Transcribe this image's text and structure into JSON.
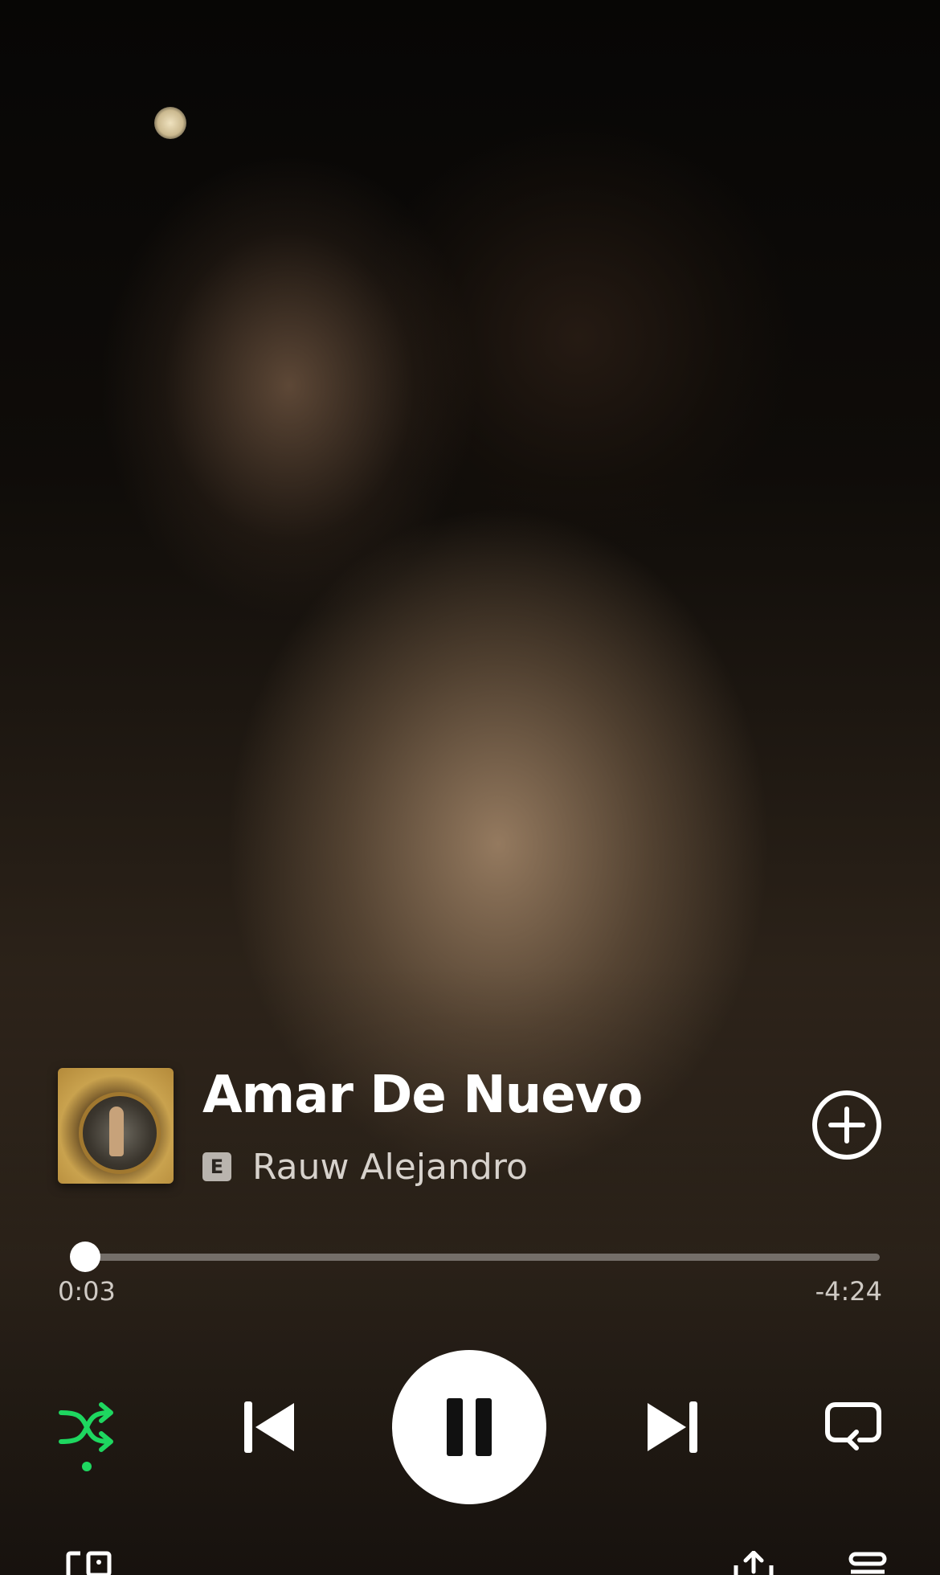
{
  "track": {
    "title": "Amar De Nuevo",
    "artist": "Rauw Alejandro",
    "explicit_badge": "E"
  },
  "playback": {
    "elapsed": "0:03",
    "remaining": "-4:24",
    "progress_fraction": 0.011,
    "state": "playing",
    "shuffle_enabled": true
  },
  "icons": {
    "add": "plus-circle-icon",
    "shuffle": "shuffle-icon",
    "previous": "skip-previous-icon",
    "pause": "pause-icon",
    "next": "skip-next-icon",
    "repeat": "repeat-icon",
    "devices": "connect-device-icon",
    "share": "share-icon",
    "queue": "queue-icon"
  },
  "colors": {
    "accent": "#1ed760",
    "text_primary": "#ffffff",
    "text_secondary": "#d7d2cc"
  }
}
